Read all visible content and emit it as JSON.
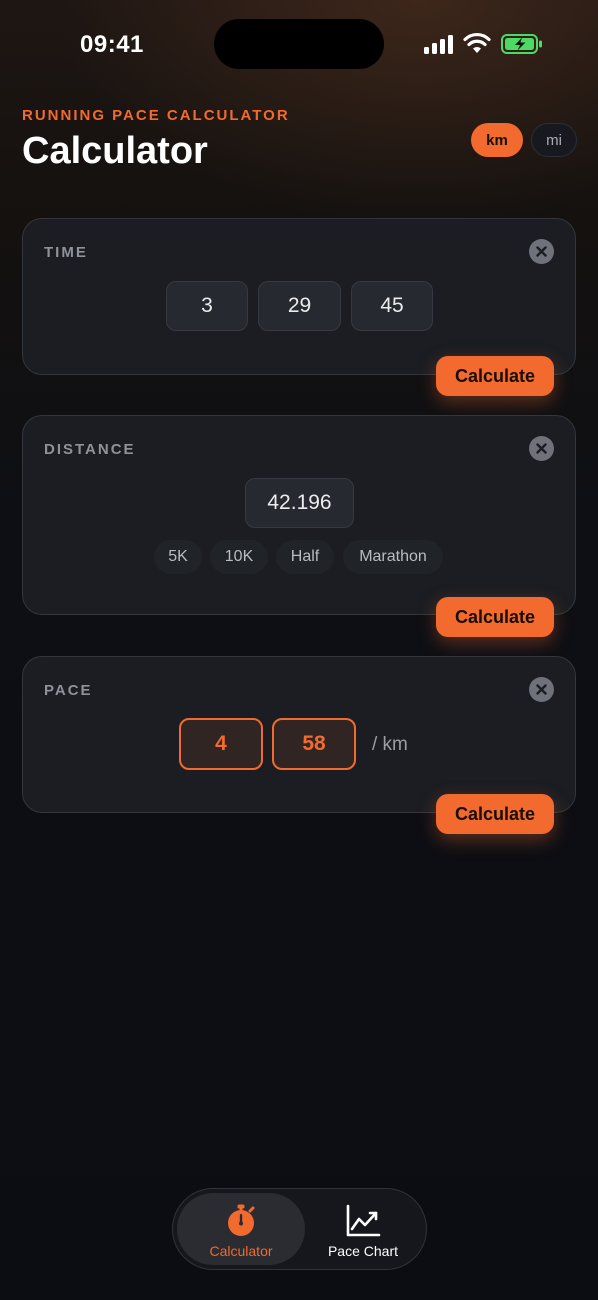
{
  "status_bar": {
    "time": "09:41"
  },
  "header": {
    "eyebrow": "RUNNING PACE CALCULATOR",
    "title": "Calculator"
  },
  "units": {
    "km_label": "km",
    "mi_label": "mi",
    "selected": "km"
  },
  "time_card": {
    "label": "TIME",
    "hours": "3",
    "minutes": "29",
    "seconds": "45",
    "button": "Calculate"
  },
  "distance_card": {
    "label": "DISTANCE",
    "value": "42.196",
    "presets": [
      "5K",
      "10K",
      "Half",
      "Marathon"
    ],
    "button": "Calculate"
  },
  "pace_card": {
    "label": "PACE",
    "minutes": "4",
    "seconds": "58",
    "suffix": "/ km",
    "button": "Calculate"
  },
  "tabs": [
    {
      "label": "Calculator",
      "icon": "stopwatch-icon",
      "active": true
    },
    {
      "label": "Pace Chart",
      "icon": "line-chart-icon",
      "active": false
    }
  ],
  "colors": {
    "accent": "#f26a2e",
    "background": "#0d0f14",
    "card": "#1b1d22",
    "battery": "#4cd964"
  }
}
